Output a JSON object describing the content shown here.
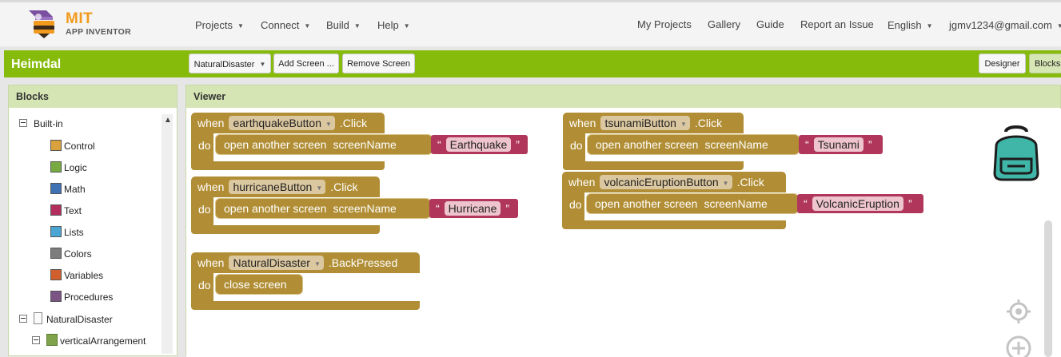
{
  "header": {
    "logo_title": "MIT",
    "logo_subtitle": "APP INVENTOR",
    "menus": [
      "Projects",
      "Connect",
      "Build",
      "Help"
    ],
    "right_links": [
      "My Projects",
      "Gallery",
      "Guide",
      "Report an Issue"
    ],
    "language": "English",
    "account": "jgmv1234@gmail.com"
  },
  "project_bar": {
    "project_name": "Heimdal",
    "screen_select": "NaturalDisaster",
    "add_screen": "Add Screen ...",
    "remove_screen": "Remove Screen",
    "designer": "Designer",
    "blocks": "Blocks"
  },
  "blocks_panel": {
    "title": "Blocks",
    "builtin_label": "Built-in",
    "categories": [
      {
        "label": "Control",
        "color": "#d9a23c"
      },
      {
        "label": "Logic",
        "color": "#77ab41"
      },
      {
        "label": "Math",
        "color": "#3f71b5"
      },
      {
        "label": "Text",
        "color": "#b32d5e"
      },
      {
        "label": "Lists",
        "color": "#49a6d4"
      },
      {
        "label": "Colors",
        "color": "#7d7d7d"
      },
      {
        "label": "Variables",
        "color": "#d05f2d"
      },
      {
        "label": "Procedures",
        "color": "#7c5385"
      }
    ],
    "screen_node": "NaturalDisaster",
    "child_node": "verticalArrangement"
  },
  "viewer": {
    "title": "Viewer",
    "when_kw": "when",
    "do_kw": "do",
    "click_suffix": ".Click",
    "back_suffix": ".BackPressed",
    "open_screen": "open another screen",
    "screen_name": "screenName",
    "close_screen": "close screen",
    "quote_open": "“",
    "quote_close": "”",
    "events": [
      {
        "component": "earthquakeButton",
        "value": "Earthquake"
      },
      {
        "component": "tsunamiButton",
        "value": "Tsunami"
      },
      {
        "component": "hurricaneButton",
        "value": "Hurricane"
      },
      {
        "component": "volcanicEruptionButton",
        "value": "VolcanicEruption"
      }
    ],
    "back_component": "NaturalDisaster"
  }
}
